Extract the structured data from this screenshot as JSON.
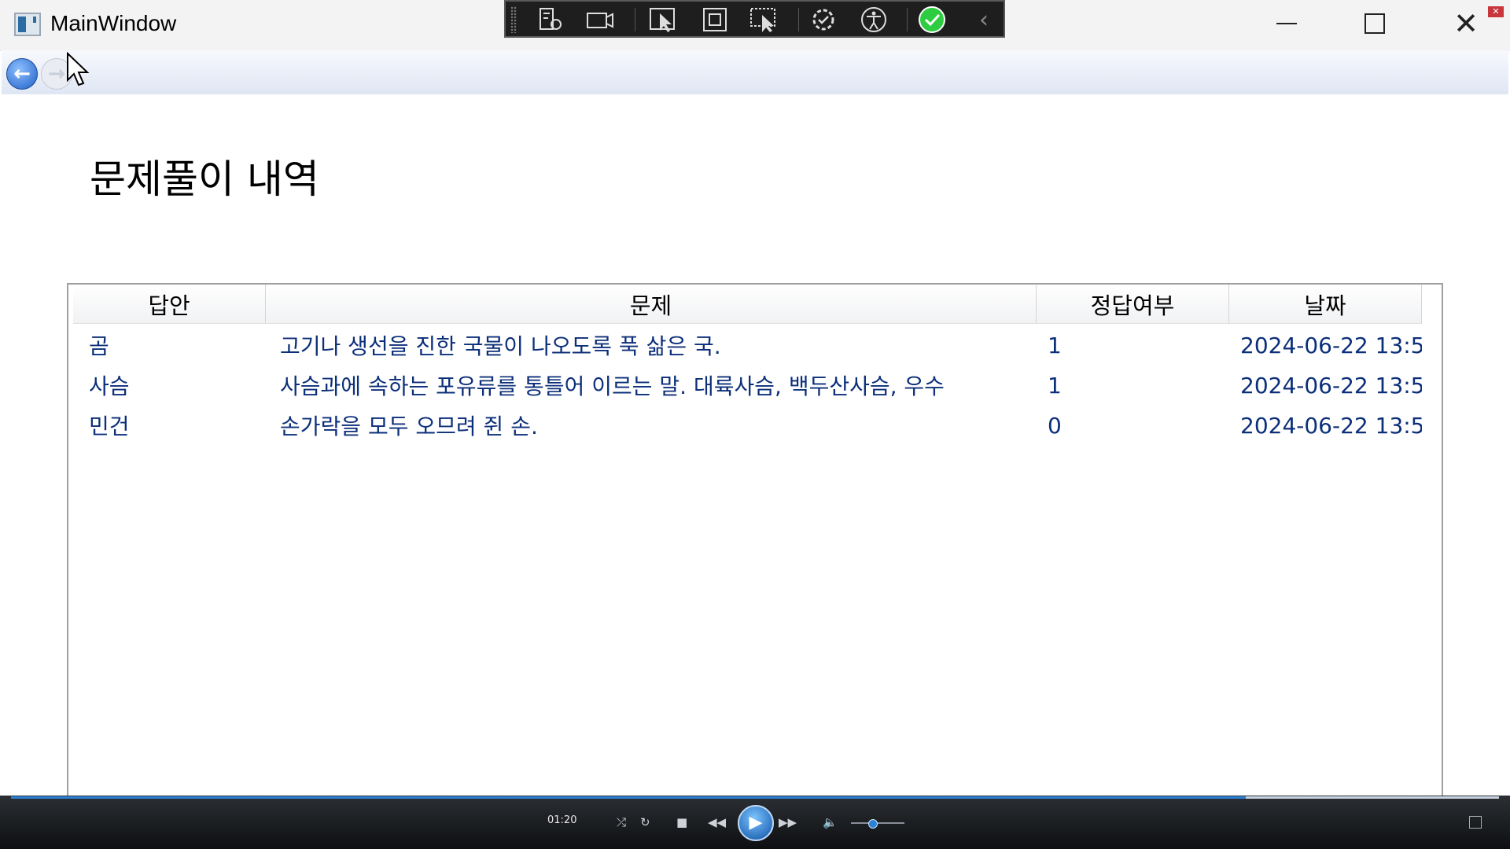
{
  "window": {
    "title": "MainWindow",
    "minimize_symbol": "",
    "close_symbol": "✕"
  },
  "debug_toolbar": {
    "icons": [
      "live-visual-tree-icon",
      "camera-icon",
      "select-element-icon",
      "display-layout-adorners-icon",
      "track-focus-icon",
      "hot-reload-icon",
      "accessibility-icon",
      "check-icon",
      "collapse-chevron-icon"
    ],
    "collapse_symbol": "‹"
  },
  "nav": {
    "back_symbol": "←",
    "forward_symbol": "→"
  },
  "page": {
    "title": "문제풀이 내역"
  },
  "table": {
    "columns": [
      "답안",
      "문제",
      "정답여부",
      "날짜"
    ],
    "rows": [
      {
        "answer": "곰",
        "question": "고기나 생선을 진한 국물이 나오도록 푹 삶은 국.",
        "correct": "1",
        "date": "2024-06-22 13:5"
      },
      {
        "answer": "사슴",
        "question": "사슴과에 속하는 포유류를 통틀어 이르는 말. 대륙사슴, 백두산사슴, 우수",
        "correct": "1",
        "date": "2024-06-22 13:5"
      },
      {
        "answer": "민건",
        "question": "손가락을 모두 오므려 쥔 손.",
        "correct": "0",
        "date": "2024-06-22 13:5"
      }
    ]
  },
  "player": {
    "time": "01:20",
    "progress": 0.83,
    "volume": 0.4,
    "accent_color": "#2a82d8"
  }
}
